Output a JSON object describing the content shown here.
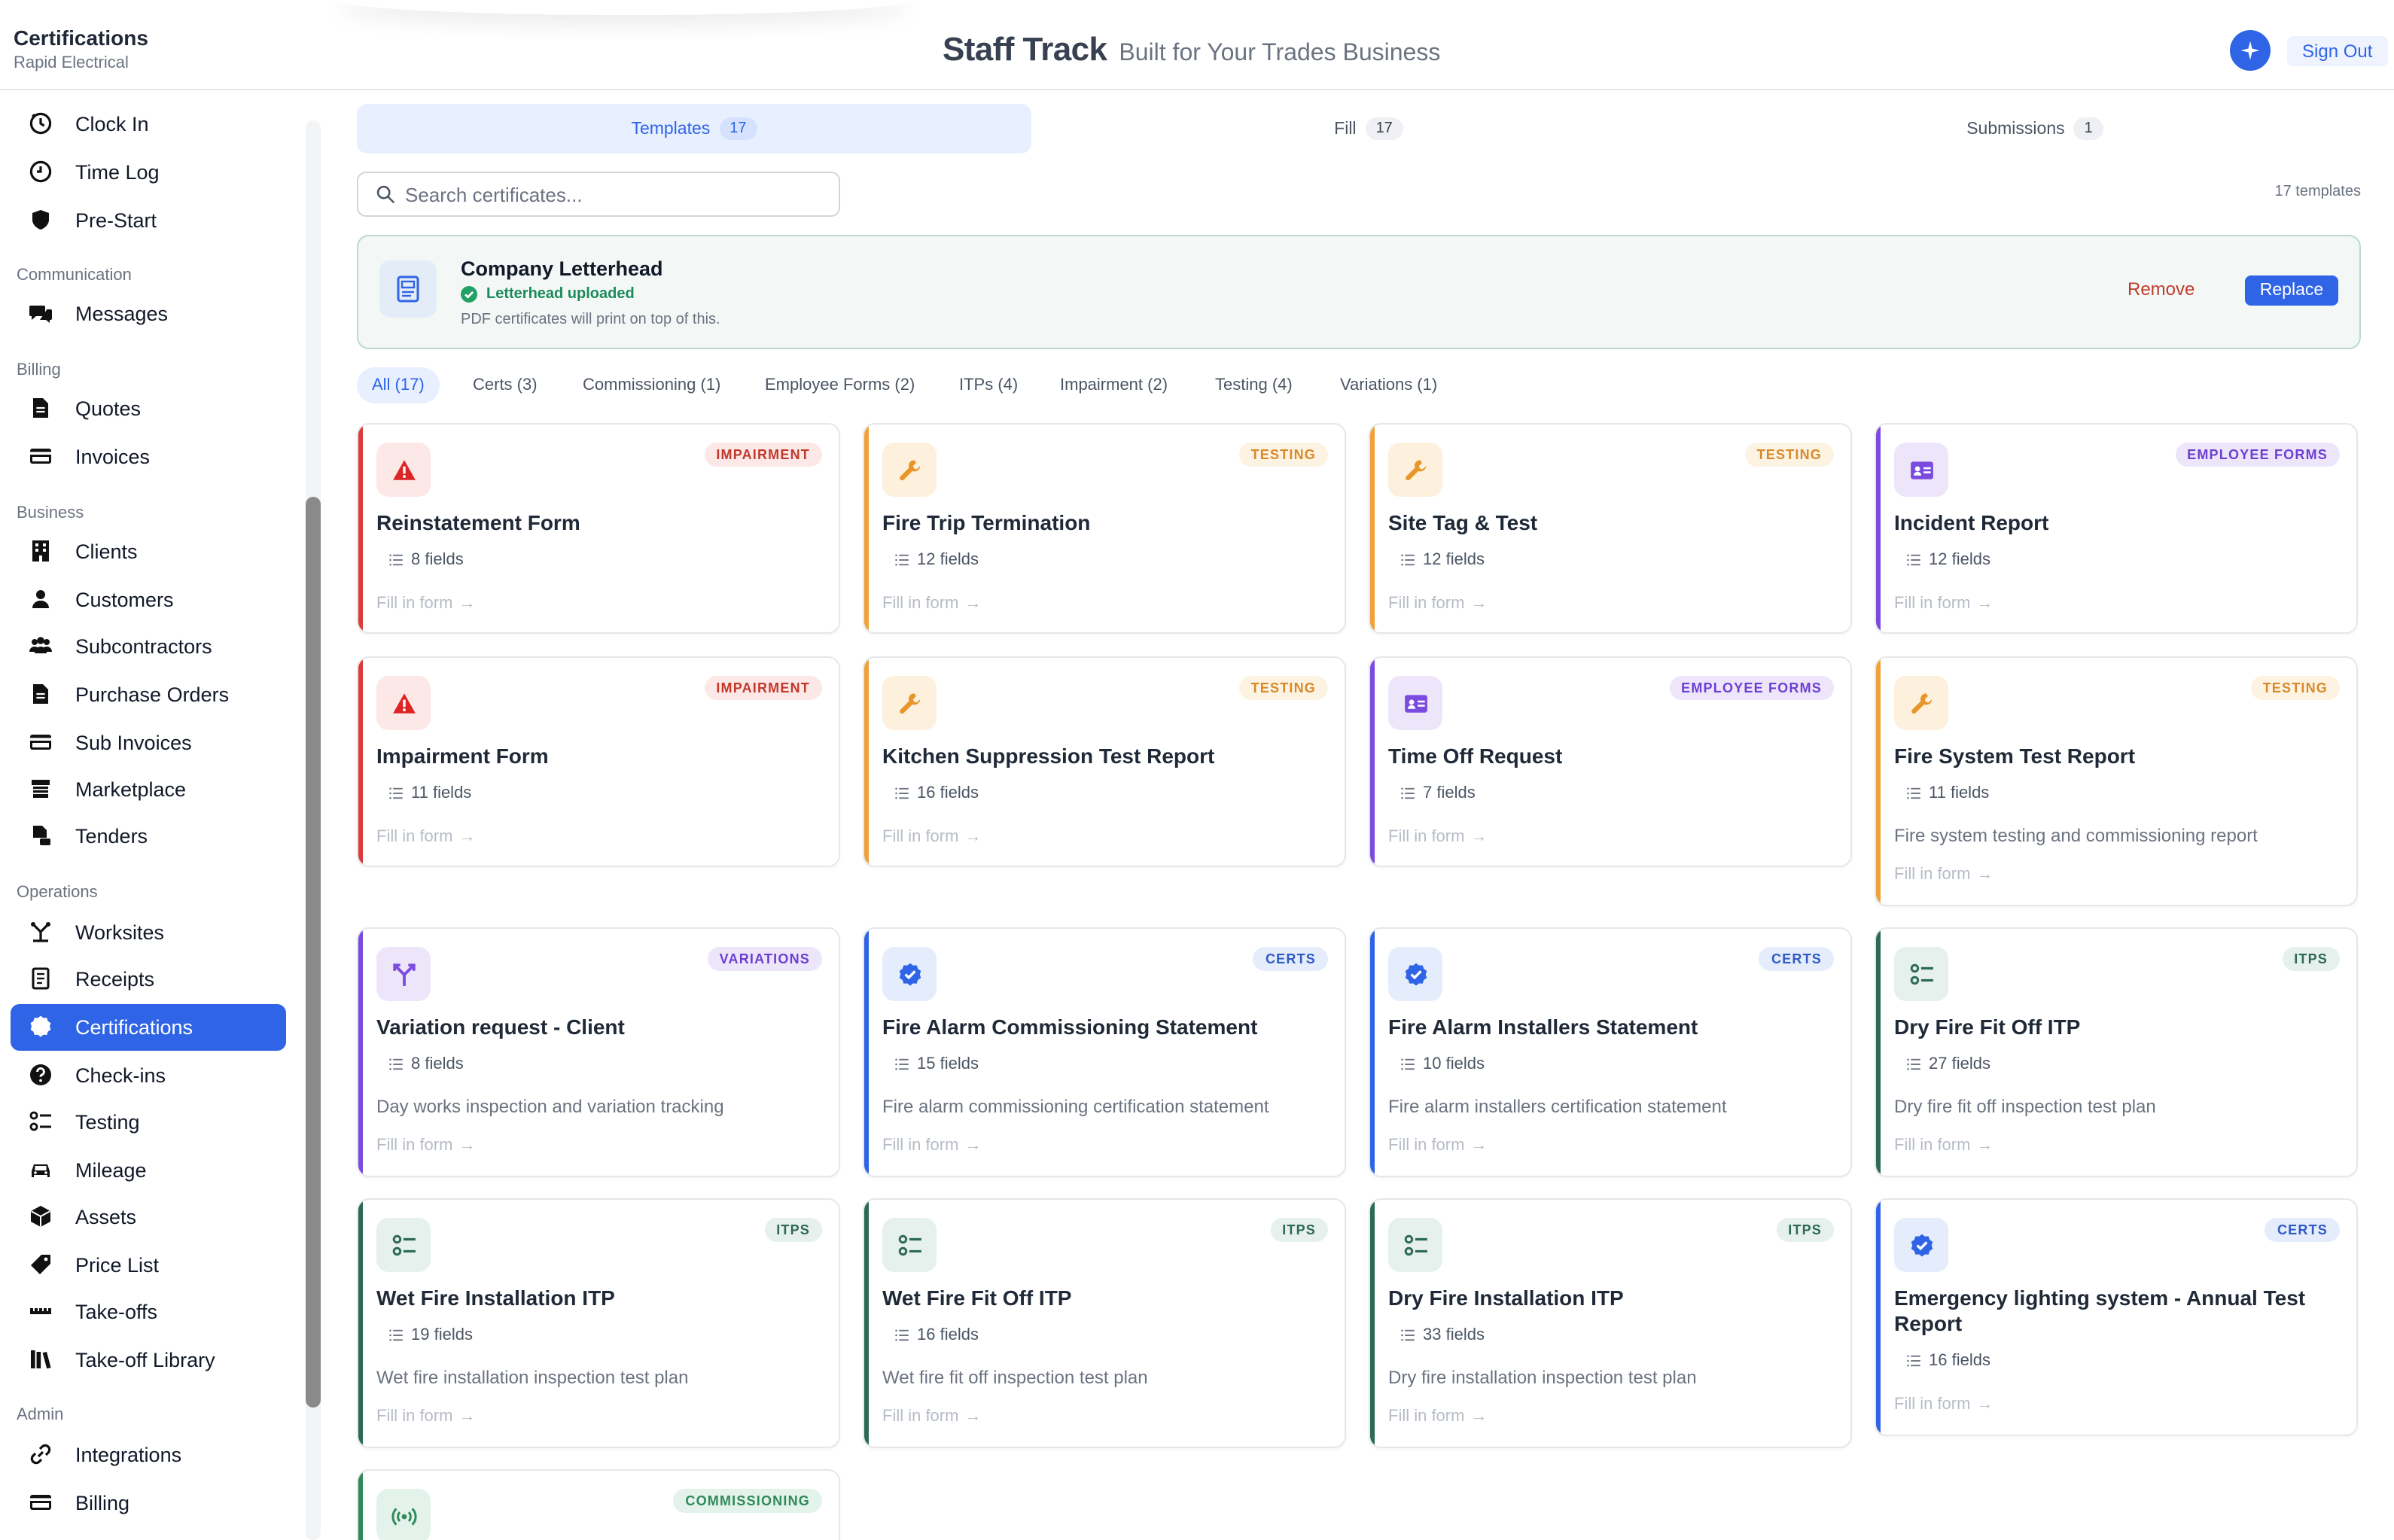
{
  "header": {
    "context_title": "Certifications",
    "context_subtitle": "Rapid Electrical",
    "brand_name": "Staff Track",
    "brand_tagline": "Built for Your Trades Business",
    "sign_out": "Sign Out",
    "accent": "#2f64e6"
  },
  "sidebar": {
    "top": [
      {
        "label": "Clock In",
        "icon": "clock-icon"
      },
      {
        "label": "Time Log",
        "icon": "clock-outline-icon"
      },
      {
        "label": "Pre-Start",
        "icon": "shield-icon"
      }
    ],
    "sections": [
      {
        "title": "Communication",
        "items": [
          {
            "label": "Messages",
            "icon": "messages-icon"
          }
        ]
      },
      {
        "title": "Billing",
        "items": [
          {
            "label": "Quotes",
            "icon": "document-icon"
          },
          {
            "label": "Invoices",
            "icon": "card-icon"
          }
        ]
      },
      {
        "title": "Business",
        "items": [
          {
            "label": "Clients",
            "icon": "building-icon"
          },
          {
            "label": "Customers",
            "icon": "user-icon"
          },
          {
            "label": "Subcontractors",
            "icon": "users-icon"
          },
          {
            "label": "Purchase Orders",
            "icon": "document-icon"
          },
          {
            "label": "Sub Invoices",
            "icon": "card-icon"
          },
          {
            "label": "Marketplace",
            "icon": "store-icon"
          },
          {
            "label": "Tenders",
            "icon": "tenders-icon"
          }
        ]
      },
      {
        "title": "Operations",
        "items": [
          {
            "label": "Worksites",
            "icon": "worksite-icon"
          },
          {
            "label": "Receipts",
            "icon": "receipt-icon"
          },
          {
            "label": "Certifications",
            "icon": "badge-check-icon",
            "active": true
          },
          {
            "label": "Check-ins",
            "icon": "question-icon"
          },
          {
            "label": "Testing",
            "icon": "checklist-icon"
          },
          {
            "label": "Mileage",
            "icon": "car-icon"
          },
          {
            "label": "Assets",
            "icon": "box-icon"
          },
          {
            "label": "Price List",
            "icon": "tag-icon"
          },
          {
            "label": "Take-offs",
            "icon": "ruler-icon"
          },
          {
            "label": "Take-off Library",
            "icon": "library-icon"
          }
        ]
      },
      {
        "title": "Admin",
        "items": [
          {
            "label": "Integrations",
            "icon": "link-icon"
          },
          {
            "label": "Billing",
            "icon": "card-icon"
          }
        ]
      }
    ]
  },
  "tabs": [
    {
      "label": "Templates",
      "count": "17",
      "active": true
    },
    {
      "label": "Fill",
      "count": "17"
    },
    {
      "label": "Submissions",
      "count": "1"
    }
  ],
  "search": {
    "placeholder": "Search certificates..."
  },
  "template_count": "17 templates",
  "letterhead": {
    "title": "Company Letterhead",
    "status": "Letterhead uploaded",
    "description": "PDF certificates will print on top of this.",
    "remove": "Remove",
    "replace": "Replace"
  },
  "filters": [
    "All (17)",
    "Certs (3)",
    "Commissioning (1)",
    "Employee Forms (2)",
    "ITPs (4)",
    "Impairment (2)",
    "Testing (4)",
    "Variations (1)"
  ],
  "category_colors": {
    "IMPAIRMENT": {
      "bar": "#dc3b3b",
      "iconbg": "#fde8e8",
      "icon": "#dc2626",
      "badgebg": "#fde8e8",
      "badgefg": "#c0392b"
    },
    "TESTING": {
      "bar": "#f0a13a",
      "iconbg": "#fdf0dc",
      "icon": "#e8962a",
      "badgebg": "#fdf3e2",
      "badgefg": "#d9892a"
    },
    "EMPLOYEE FORMS": {
      "bar": "#7b4be0",
      "iconbg": "#ede6fb",
      "icon": "#7b4be0",
      "badgebg": "#ede6fb",
      "badgefg": "#6d3fd1"
    },
    "VARIATIONS": {
      "bar": "#7b4be0",
      "iconbg": "#ede6fb",
      "icon": "#7b4be0",
      "badgebg": "#ede6fb",
      "badgefg": "#6d3fd1"
    },
    "CERTS": {
      "bar": "#2f64e6",
      "iconbg": "#e5ecfb",
      "icon": "#2f64e6",
      "badgebg": "#e5ecfb",
      "badgefg": "#2f5bc7"
    },
    "ITPS": {
      "bar": "#2d6a55",
      "iconbg": "#e6f0ec",
      "icon": "#2d6a55",
      "badgebg": "#e6f0ec",
      "badgefg": "#2d6a55"
    },
    "COMMISSIONING": {
      "bar": "#2f8a5a",
      "iconbg": "#e3f2ea",
      "icon": "#2f8a5a",
      "badgebg": "#e3f2ea",
      "badgefg": "#2f8a5a"
    }
  },
  "fill_label": "Fill in form",
  "cards": [
    {
      "title": "Reinstatement Form",
      "category": "IMPAIRMENT",
      "fields": "8 fields",
      "description": "",
      "icon": "warning-icon"
    },
    {
      "title": "Fire Trip Termination",
      "category": "TESTING",
      "fields": "12 fields",
      "description": "",
      "icon": "wrench-icon"
    },
    {
      "title": "Site Tag & Test",
      "category": "TESTING",
      "fields": "12 fields",
      "description": "",
      "icon": "wrench-icon"
    },
    {
      "title": "Incident Report",
      "category": "EMPLOYEE FORMS",
      "fields": "12 fields",
      "description": "",
      "icon": "id-card-icon"
    },
    {
      "title": "Impairment Form",
      "category": "IMPAIRMENT",
      "fields": "11 fields",
      "description": "",
      "icon": "warning-icon"
    },
    {
      "title": "Kitchen Suppression Test Report",
      "category": "TESTING",
      "fields": "16 fields",
      "description": "",
      "icon": "wrench-icon"
    },
    {
      "title": "Time Off Request",
      "category": "EMPLOYEE FORMS",
      "fields": "7 fields",
      "description": "",
      "icon": "id-card-icon"
    },
    {
      "title": "Fire System Test Report",
      "category": "TESTING",
      "fields": "11 fields",
      "description": "Fire system testing and commissioning report",
      "icon": "wrench-icon"
    },
    {
      "title": "Variation request - Client",
      "category": "VARIATIONS",
      "fields": "8 fields",
      "description": "Day works inspection and variation tracking",
      "icon": "split-icon"
    },
    {
      "title": "Fire Alarm Commissioning Statement",
      "category": "CERTS",
      "fields": "15 fields",
      "description": "Fire alarm commissioning certification statement",
      "icon": "badge-check-icon"
    },
    {
      "title": "Fire Alarm Installers Statement",
      "category": "CERTS",
      "fields": "10 fields",
      "description": "Fire alarm installers certification statement",
      "icon": "badge-check-icon"
    },
    {
      "title": "Dry Fire Fit Off ITP",
      "category": "ITPS",
      "fields": "27 fields",
      "description": "Dry fire fit off inspection test plan",
      "icon": "checklist-icon"
    },
    {
      "title": "Wet Fire Installation ITP",
      "category": "ITPS",
      "fields": "19 fields",
      "description": "Wet fire installation inspection test plan",
      "icon": "checklist-icon"
    },
    {
      "title": "Wet Fire Fit Off ITP",
      "category": "ITPS",
      "fields": "16 fields",
      "description": "Wet fire fit off inspection test plan",
      "icon": "checklist-icon"
    },
    {
      "title": "Dry Fire Installation ITP",
      "category": "ITPS",
      "fields": "33 fields",
      "description": "Dry fire installation inspection test plan",
      "icon": "checklist-icon"
    },
    {
      "title": "Emergency lighting system - Annual Test Report",
      "category": "CERTS",
      "fields": "16 fields",
      "description": "",
      "icon": "badge-check-icon"
    },
    {
      "title": "",
      "category": "COMMISSIONING",
      "fields": "",
      "description": "",
      "icon": "broadcast-icon"
    }
  ]
}
